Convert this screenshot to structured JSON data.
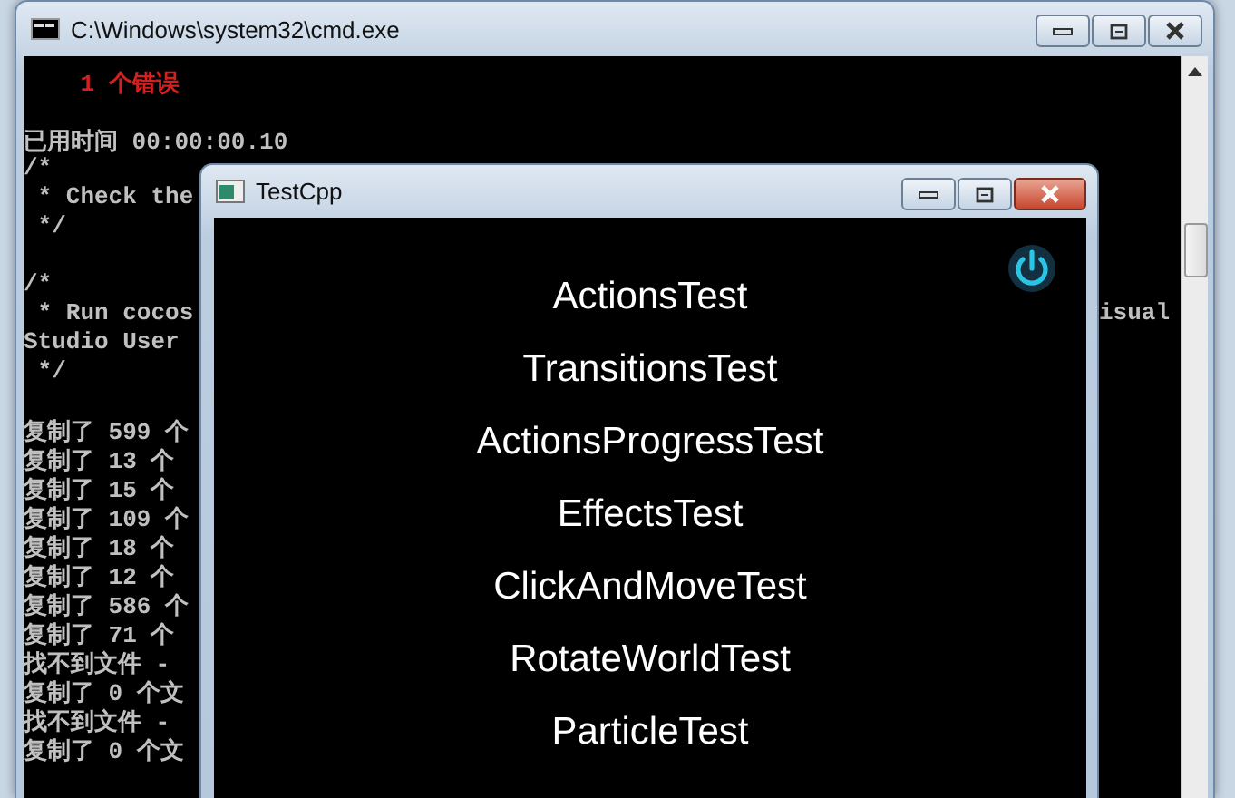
{
  "console_window": {
    "title": "C:\\Windows\\system32\\cmd.exe",
    "lines": [
      {
        "text": "    1 个错误",
        "kind": "error"
      },
      {
        "kind": "blank"
      },
      {
        "text": "已用时间 00:00:00.10",
        "kind": "normal"
      },
      {
        "text": "/*",
        "kind": "normal"
      },
      {
        "text": " * Check the",
        "kind": "normal"
      },
      {
        "text": " */",
        "kind": "normal"
      },
      {
        "kind": "blank"
      },
      {
        "text": "/*",
        "kind": "normal"
      },
      {
        "text": " * Run cocos",
        "kind": "normal",
        "tail": "isual"
      },
      {
        "text": "Studio User",
        "kind": "normal"
      },
      {
        "text": " */",
        "kind": "normal"
      },
      {
        "kind": "blank"
      },
      {
        "text": "复制了 599 个",
        "kind": "normal"
      },
      {
        "text": "复制了 13 个",
        "kind": "normal"
      },
      {
        "text": "复制了 15 个",
        "kind": "normal"
      },
      {
        "text": "复制了 109 个",
        "kind": "normal"
      },
      {
        "text": "复制了 18 个",
        "kind": "normal"
      },
      {
        "text": "复制了 12 个",
        "kind": "normal"
      },
      {
        "text": "复制了 586 个",
        "kind": "normal"
      },
      {
        "text": "复制了 71 个",
        "kind": "normal"
      },
      {
        "text": "找不到文件 -",
        "kind": "normal"
      },
      {
        "text": "复制了 0 个文",
        "kind": "normal"
      },
      {
        "text": "找不到文件 -",
        "kind": "normal"
      },
      {
        "text": "复制了 0 个文",
        "kind": "normal"
      }
    ]
  },
  "app_window": {
    "title": "TestCpp",
    "active": true,
    "menu_items": [
      "ActionsTest",
      "TransitionsTest",
      "ActionsProgressTest",
      "EffectsTest",
      "ClickAndMoveTest",
      "RotateWorldTest",
      "ParticleTest"
    ]
  }
}
